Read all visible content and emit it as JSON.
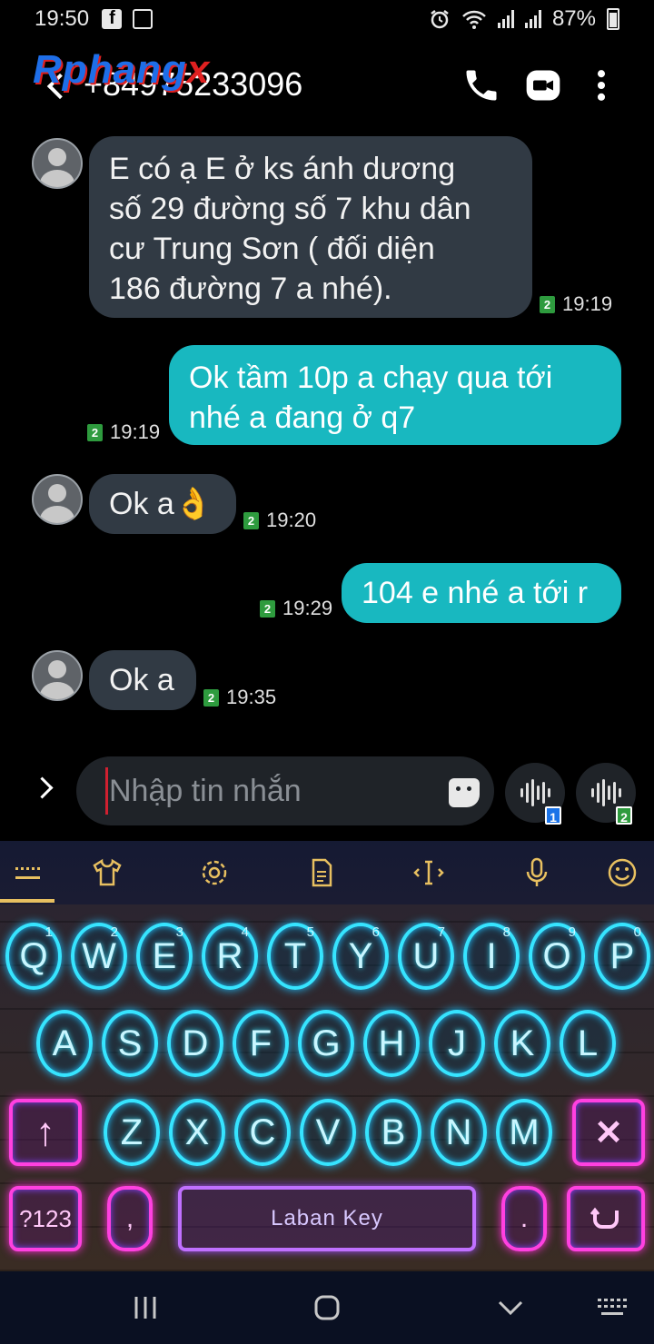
{
  "status_bar": {
    "time": "19:50",
    "battery": "87%"
  },
  "header": {
    "contact": "+84975233096",
    "watermark_main": "Rphang",
    "watermark_x": "x"
  },
  "messages": [
    {
      "direction": "incoming",
      "text": "E có ạ E ở ks ánh dương số 29 đường số 7 khu dân cư Trung Sơn ( đối diện 186 đường 7 a nhé).",
      "lines": [
        "E có ạ E ở ks ánh dương",
        "số 29 đường số 7 khu dân",
        "cư Trung Sơn ( đối diện",
        "186 đường 7 a nhé)."
      ],
      "sim": "2",
      "time": "19:19"
    },
    {
      "direction": "outgoing",
      "text": "Ok tầm 10p a chạy qua tới nhé a đang ở q7",
      "lines": [
        "Ok tầm 10p a chạy qua tới",
        "nhé a đang ở q7"
      ],
      "sim": "2",
      "time": "19:19"
    },
    {
      "direction": "incoming",
      "text": "Ok a👌",
      "lines": [
        "Ok a👌"
      ],
      "sim": "2",
      "time": "19:20"
    },
    {
      "direction": "outgoing",
      "text": "104 e nhé a tới r",
      "lines": [
        "104 e nhé a tới r"
      ],
      "sim": "2",
      "time": "19:29"
    },
    {
      "direction": "incoming",
      "text": "Ok a",
      "lines": [
        "Ok a"
      ],
      "sim": "2",
      "time": "19:35"
    }
  ],
  "composer": {
    "placeholder": "Nhập tin nhắn",
    "voice_sim_1": "1",
    "voice_sim_2": "2"
  },
  "keyboard": {
    "row1": [
      {
        "k": "Q",
        "n": "1"
      },
      {
        "k": "W",
        "n": "2"
      },
      {
        "k": "E",
        "n": "3"
      },
      {
        "k": "R",
        "n": "4"
      },
      {
        "k": "T",
        "n": "5"
      },
      {
        "k": "Y",
        "n": "6"
      },
      {
        "k": "U",
        "n": "7"
      },
      {
        "k": "I",
        "n": "8"
      },
      {
        "k": "O",
        "n": "9"
      },
      {
        "k": "P",
        "n": "0"
      }
    ],
    "row2": [
      "A",
      "S",
      "D",
      "F",
      "G",
      "H",
      "J",
      "K",
      "L"
    ],
    "row3": [
      "Z",
      "X",
      "C",
      "V",
      "B",
      "N",
      "M"
    ],
    "symbols_label": "?123",
    "comma_label": ",",
    "period_label": ".",
    "space_label": "Laban Key"
  },
  "colors": {
    "incoming_bubble": "#313a44",
    "outgoing_bubble": "#18b8c0",
    "neon_cyan": "#36e4ff",
    "neon_pink": "#ff40e0",
    "sim_green": "#2e9b3e"
  }
}
